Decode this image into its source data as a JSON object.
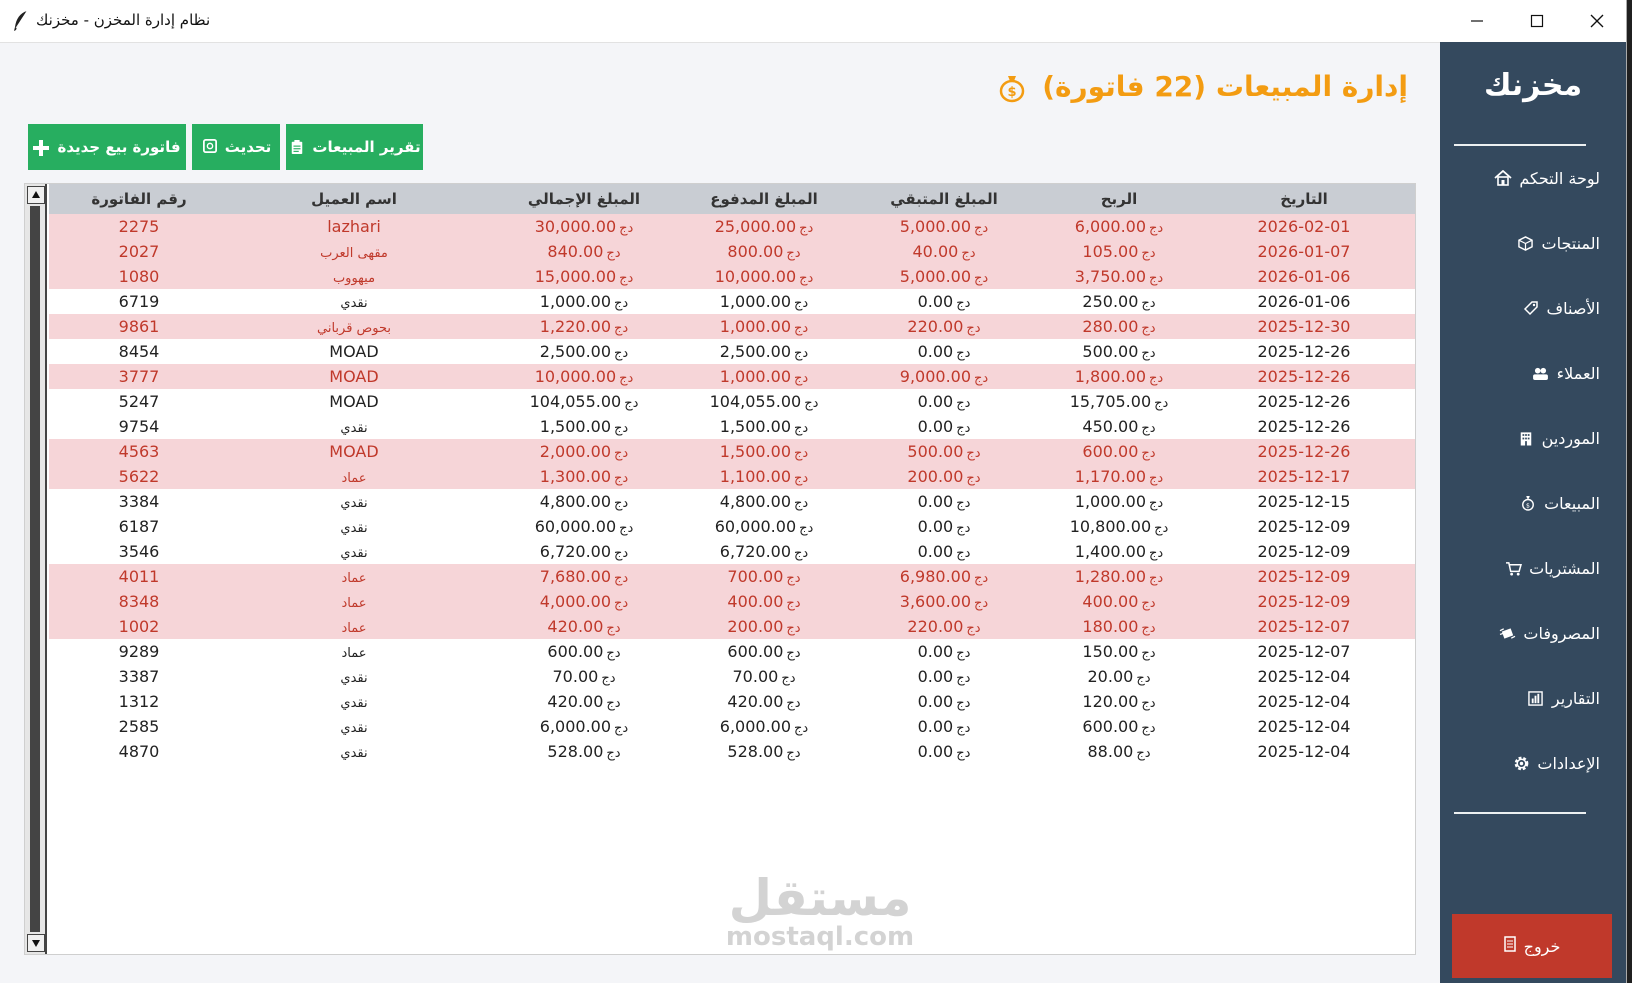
{
  "window": {
    "title": "نظام إدارة المخزن - مخزنك"
  },
  "sidebar": {
    "brand": "مخزنك",
    "items": [
      {
        "label": "لوحة التحكم",
        "icon": "home-icon"
      },
      {
        "label": "المنتجات",
        "icon": "box-icon"
      },
      {
        "label": "الأصناف",
        "icon": "tag-icon"
      },
      {
        "label": "العملاء",
        "icon": "users-icon"
      },
      {
        "label": "الموردين",
        "icon": "building-icon"
      },
      {
        "label": "المبيعات",
        "icon": "money-bag-icon"
      },
      {
        "label": "المشتريات",
        "icon": "cart-icon"
      },
      {
        "label": "المصروفات",
        "icon": "money-wings-icon"
      },
      {
        "label": "التقارير",
        "icon": "bar-chart-icon"
      },
      {
        "label": "الإعدادات",
        "icon": "gear-icon"
      }
    ],
    "logout": "خروج"
  },
  "main": {
    "title": "إدارة المبيعات (22 فاتورة)",
    "buttons": {
      "new_invoice": "فاتورة بيع جديدة",
      "refresh": "تحديث",
      "report": "تقرير المبيعات"
    },
    "currency": "دج",
    "columns": {
      "invoice": "رقم الفاتورة",
      "customer": "اسم العميل",
      "total": "المبلغ الإجمالي",
      "paid": "المبلغ المدفوع",
      "remaining": "المبلغ المتبقي",
      "profit": "الربح",
      "date": "التاريخ"
    },
    "rows": [
      {
        "invoice": "2275",
        "customer": "lazhari",
        "total": "30,000.00",
        "paid": "25,000.00",
        "remaining": "5,000.00",
        "profit": "6,000.00",
        "date": "2026-02-01",
        "unpaid": true
      },
      {
        "invoice": "2027",
        "customer": "مقهى العرب",
        "total": "840.00",
        "paid": "800.00",
        "remaining": "40.00",
        "profit": "105.00",
        "date": "2026-01-07",
        "unpaid": true
      },
      {
        "invoice": "1080",
        "customer": "ميهووب",
        "total": "15,000.00",
        "paid": "10,000.00",
        "remaining": "5,000.00",
        "profit": "3,750.00",
        "date": "2026-01-06",
        "unpaid": true
      },
      {
        "invoice": "6719",
        "customer": "نقدي",
        "total": "1,000.00",
        "paid": "1,000.00",
        "remaining": "0.00",
        "profit": "250.00",
        "date": "2026-01-06",
        "unpaid": false
      },
      {
        "invoice": "9861",
        "customer": "بحوص قرباني",
        "total": "1,220.00",
        "paid": "1,000.00",
        "remaining": "220.00",
        "profit": "280.00",
        "date": "2025-12-30",
        "unpaid": true
      },
      {
        "invoice": "8454",
        "customer": "MOAD",
        "total": "2,500.00",
        "paid": "2,500.00",
        "remaining": "0.00",
        "profit": "500.00",
        "date": "2025-12-26",
        "unpaid": false
      },
      {
        "invoice": "3777",
        "customer": "MOAD",
        "total": "10,000.00",
        "paid": "1,000.00",
        "remaining": "9,000.00",
        "profit": "1,800.00",
        "date": "2025-12-26",
        "unpaid": true
      },
      {
        "invoice": "5247",
        "customer": "MOAD",
        "total": "104,055.00",
        "paid": "104,055.00",
        "remaining": "0.00",
        "profit": "15,705.00",
        "date": "2025-12-26",
        "unpaid": false
      },
      {
        "invoice": "9754",
        "customer": "نقدي",
        "total": "1,500.00",
        "paid": "1,500.00",
        "remaining": "0.00",
        "profit": "450.00",
        "date": "2025-12-26",
        "unpaid": false
      },
      {
        "invoice": "4563",
        "customer": "MOAD",
        "total": "2,000.00",
        "paid": "1,500.00",
        "remaining": "500.00",
        "profit": "600.00",
        "date": "2025-12-26",
        "unpaid": true
      },
      {
        "invoice": "5622",
        "customer": "عماد",
        "total": "1,300.00",
        "paid": "1,100.00",
        "remaining": "200.00",
        "profit": "1,170.00",
        "date": "2025-12-17",
        "unpaid": true
      },
      {
        "invoice": "3384",
        "customer": "نقدي",
        "total": "4,800.00",
        "paid": "4,800.00",
        "remaining": "0.00",
        "profit": "1,000.00",
        "date": "2025-12-15",
        "unpaid": false
      },
      {
        "invoice": "6187",
        "customer": "نقدي",
        "total": "60,000.00",
        "paid": "60,000.00",
        "remaining": "0.00",
        "profit": "10,800.00",
        "date": "2025-12-09",
        "unpaid": false
      },
      {
        "invoice": "3546",
        "customer": "نقدي",
        "total": "6,720.00",
        "paid": "6,720.00",
        "remaining": "0.00",
        "profit": "1,400.00",
        "date": "2025-12-09",
        "unpaid": false
      },
      {
        "invoice": "4011",
        "customer": "عماد",
        "total": "7,680.00",
        "paid": "700.00",
        "remaining": "6,980.00",
        "profit": "1,280.00",
        "date": "2025-12-09",
        "unpaid": true
      },
      {
        "invoice": "8348",
        "customer": "عماد",
        "total": "4,000.00",
        "paid": "400.00",
        "remaining": "3,600.00",
        "profit": "400.00",
        "date": "2025-12-09",
        "unpaid": true
      },
      {
        "invoice": "1002",
        "customer": "عماد",
        "total": "420.00",
        "paid": "200.00",
        "remaining": "220.00",
        "profit": "180.00",
        "date": "2025-12-07",
        "unpaid": true
      },
      {
        "invoice": "9289",
        "customer": "عماد",
        "total": "600.00",
        "paid": "600.00",
        "remaining": "0.00",
        "profit": "150.00",
        "date": "2025-12-07",
        "unpaid": false
      },
      {
        "invoice": "3387",
        "customer": "نقدي",
        "total": "70.00",
        "paid": "70.00",
        "remaining": "0.00",
        "profit": "20.00",
        "date": "2025-12-04",
        "unpaid": false
      },
      {
        "invoice": "1312",
        "customer": "نقدي",
        "total": "420.00",
        "paid": "420.00",
        "remaining": "0.00",
        "profit": "120.00",
        "date": "2025-12-04",
        "unpaid": false
      },
      {
        "invoice": "2585",
        "customer": "نقدي",
        "total": "6,000.00",
        "paid": "6,000.00",
        "remaining": "0.00",
        "profit": "600.00",
        "date": "2025-12-04",
        "unpaid": false
      },
      {
        "invoice": "4870",
        "customer": "نقدي",
        "total": "528.00",
        "paid": "528.00",
        "remaining": "0.00",
        "profit": "88.00",
        "date": "2025-12-04",
        "unpaid": false
      }
    ]
  },
  "watermark": {
    "arabic": "مستقل",
    "latin": "mostaql.com"
  },
  "colors": {
    "sidebar_bg": "#34495e",
    "accent_orange": "#f39c12",
    "button_green": "#27ae60",
    "logout_red": "#c0392b",
    "unpaid_row_bg": "#f6d5d8",
    "unpaid_row_text": "#c0392b"
  }
}
